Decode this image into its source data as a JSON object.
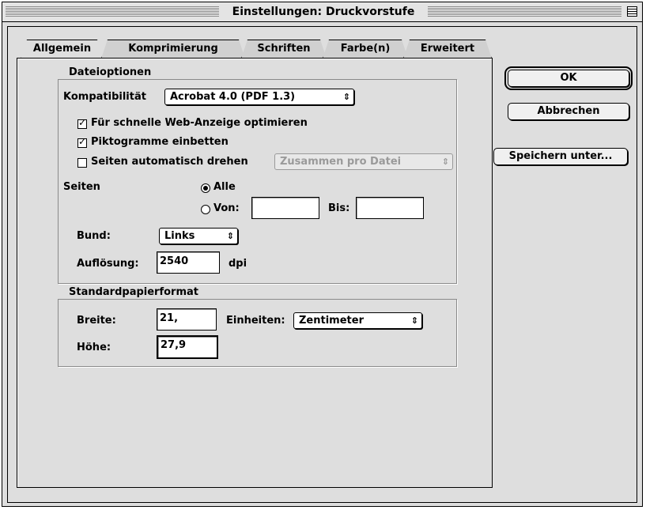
{
  "window": {
    "title": "Einstellungen: Druckvorstufe"
  },
  "tabs": [
    {
      "label": "Allgemein",
      "active": true
    },
    {
      "label": "Komprimierung",
      "active": false
    },
    {
      "label": "Schriften",
      "active": false
    },
    {
      "label": "Farbe(n)",
      "active": false
    },
    {
      "label": "Erweitert",
      "active": false
    }
  ],
  "dateioptionen": {
    "legend": "Dateioptionen",
    "kompat_label": "Kompatibilität",
    "kompat_value": "Acrobat 4.0 (PDF 1.3)",
    "opt_web": "Für schnelle Web-Anzeige optimieren",
    "opt_web_checked": true,
    "opt_icons": "Piktogramme einbetten",
    "opt_icons_checked": true,
    "opt_rotate": "Seiten automatisch drehen",
    "opt_rotate_checked": false,
    "rotate_mode": "Zusammen pro Datei",
    "seiten_label": "Seiten",
    "alle_label": "Alle",
    "von_label": "Von:",
    "von_value": "",
    "bis_label": "Bis:",
    "bis_value": "",
    "bund_label": "Bund:",
    "bund_value": "Links",
    "aufl_label": "Auflösung:",
    "aufl_value": "2540",
    "dpi_label": "dpi"
  },
  "papier": {
    "legend": "Standardpapierformat",
    "breite_label": "Breite:",
    "breite_value": "21,",
    "einheiten_label": "Einheiten:",
    "einheiten_value": "Zentimeter",
    "hoehe_label": "Höhe:",
    "hoehe_value": "27,9"
  },
  "buttons": {
    "ok": "OK",
    "cancel": "Abbrechen",
    "save_as": "Speichern unter..."
  },
  "icons": {
    "popup_arrow": "⇕"
  }
}
